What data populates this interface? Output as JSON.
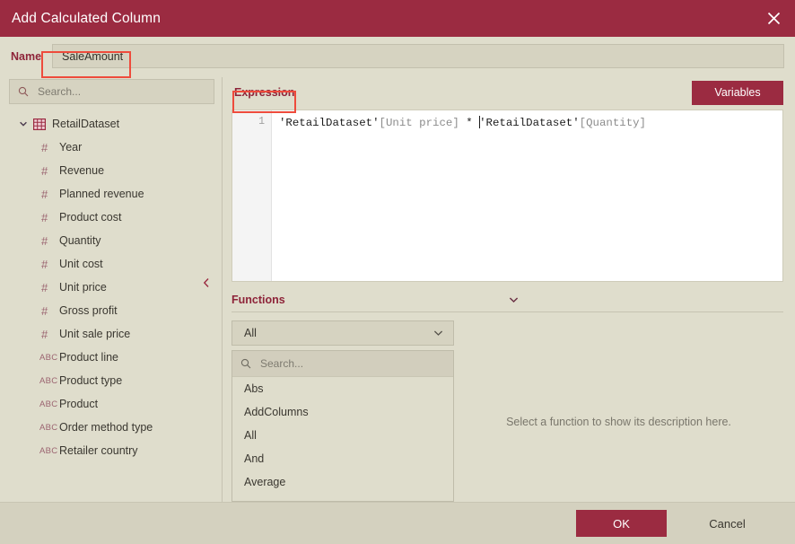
{
  "window": {
    "title": "Add Calculated Column",
    "close_icon": "close-icon"
  },
  "name_field": {
    "label": "Name",
    "value": "SaleAmount",
    "placeholder": ""
  },
  "sidebar": {
    "search": {
      "placeholder": "Search...",
      "value": "",
      "icon": "search-icon"
    },
    "dataset": {
      "label": "RetailDataset",
      "icon": "table-icon",
      "expanded": true,
      "caret_icon": "chevron-down-icon"
    },
    "fields": [
      {
        "label": "Year",
        "type": "#"
      },
      {
        "label": "Revenue",
        "type": "#"
      },
      {
        "label": "Planned revenue",
        "type": "#"
      },
      {
        "label": "Product cost",
        "type": "#"
      },
      {
        "label": "Quantity",
        "type": "#"
      },
      {
        "label": "Unit cost",
        "type": "#"
      },
      {
        "label": "Unit price",
        "type": "#"
      },
      {
        "label": "Gross profit",
        "type": "#"
      },
      {
        "label": "Unit sale price",
        "type": "#"
      },
      {
        "label": "Product line",
        "type": "ABC"
      },
      {
        "label": "Product type",
        "type": "ABC"
      },
      {
        "label": "Product",
        "type": "ABC"
      },
      {
        "label": "Order method type",
        "type": "ABC"
      },
      {
        "label": "Retailer country",
        "type": "ABC"
      }
    ],
    "collapse_icon": "chevron-left-icon"
  },
  "expression": {
    "label": "Expression",
    "variables_button": "Variables",
    "line_number": "1",
    "tokens": {
      "table1": "'RetailDataset'",
      "column1": "[Unit price]",
      "operator": " * ",
      "table2": "'RetailDataset'",
      "column2": "[Quantity]"
    },
    "full_text": "'RetailDataset'[Unit price] * 'RetailDataset'[Quantity]"
  },
  "functions": {
    "title": "Functions",
    "collapse_icon": "chevron-down-icon",
    "category_selected": "All",
    "category_caret": "chevron-down-icon",
    "search": {
      "placeholder": "Search...",
      "value": "",
      "icon": "search-icon"
    },
    "items": [
      "Abs",
      "AddColumns",
      "All",
      "And",
      "Average"
    ],
    "description_placeholder": "Select a function to show its description here."
  },
  "footer": {
    "ok": "OK",
    "cancel": "Cancel"
  },
  "colors": {
    "accent": "#9B2B41",
    "label_accent": "#8E2439",
    "background": "#DFDDCC",
    "footer_bg": "#D4D1BF",
    "highlight_box": "#EE4B3C",
    "editor_bg": "#FFFFFF"
  }
}
